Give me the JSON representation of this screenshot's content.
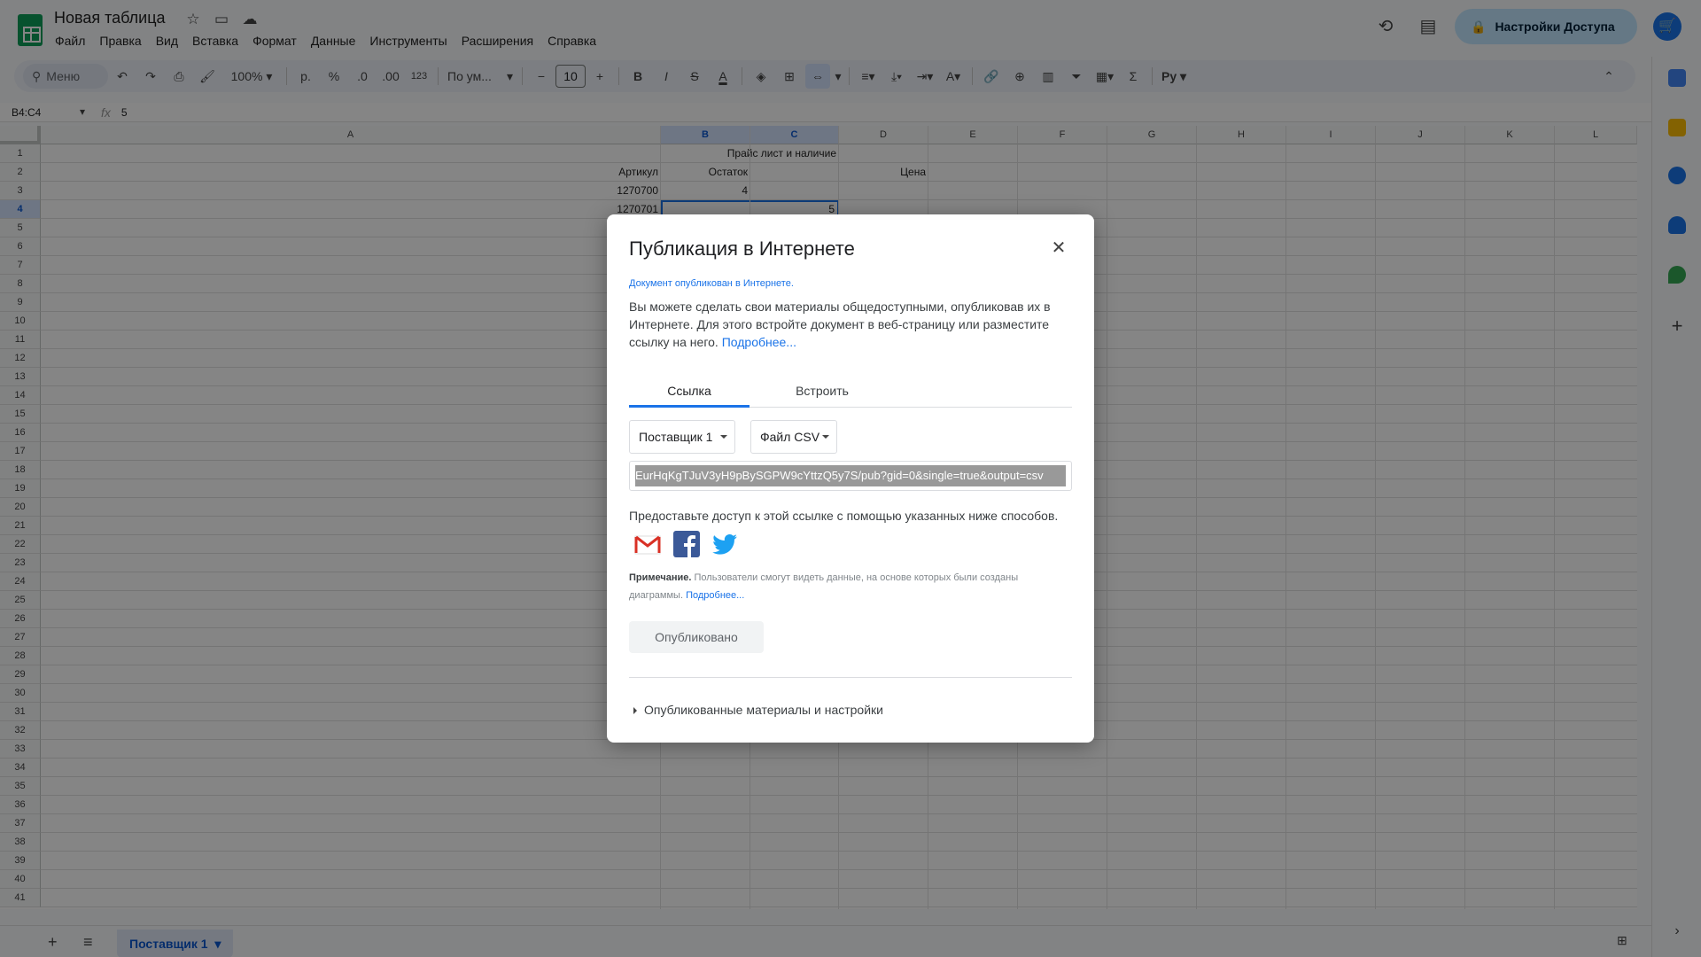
{
  "doc": {
    "title": "Новая таблица"
  },
  "menu": [
    "Файл",
    "Правка",
    "Вид",
    "Вставка",
    "Формат",
    "Данные",
    "Инструменты",
    "Расширения",
    "Справка"
  ],
  "header": {
    "share_label": "Настройки Доступа"
  },
  "toolbar": {
    "search_placeholder": "Меню",
    "zoom": "100%",
    "currency": "р.",
    "percent": "%",
    "dec_decrease": ".0",
    "dec_increase": ".00",
    "number_format": "123",
    "font": "По ум...",
    "font_size": "10",
    "bold": "B",
    "italic": "I",
    "strike": "S",
    "text_color": "A",
    "rotate": "A",
    "input_tools": "Ру"
  },
  "formula_bar": {
    "name_box": "B4:C4",
    "fx": "fx",
    "value": "5"
  },
  "columns": [
    "A",
    "B",
    "C",
    "D",
    "E",
    "F",
    "G",
    "H",
    "I",
    "J",
    "K",
    "L"
  ],
  "rows": [
    "1",
    "2",
    "3",
    "4",
    "5",
    "6",
    "7",
    "8",
    "9",
    "10",
    "11",
    "12",
    "13",
    "14",
    "15",
    "16",
    "17",
    "18",
    "19",
    "20",
    "21",
    "22",
    "23",
    "24",
    "25",
    "26",
    "27",
    "28",
    "29",
    "30",
    "31",
    "32",
    "33",
    "34",
    "35",
    "36",
    "37",
    "38",
    "39",
    "40",
    "41"
  ],
  "cells": {
    "b1": "Прайс лист и наличие",
    "a2": "Артикул",
    "b2": "Остаток",
    "d2": "Цена",
    "a3": "1270700",
    "b3": "4",
    "a4": "1270701",
    "c4": "5"
  },
  "sheets": [
    {
      "name": "Поставщик 1"
    }
  ],
  "dialog": {
    "title": "Публикация в Интернете",
    "status": "Документ опубликован в Интернете.",
    "description": "Вы можете сделать свои материалы общедоступными, опубликовав их в Интернете. Для этого встройте документ в веб-страницу или разместите ссылку на него.",
    "more_link": "Подробнее...",
    "tabs": [
      "Ссылка",
      "Встроить"
    ],
    "sheet_select": "Поставщик 1",
    "format_select": "Файл CSV",
    "url": "EurHqKgTJuV3yH9pBySGPW9cYttzQ5y7S/pub?gid=0&single=true&output=csv",
    "share_text": "Предоставьте доступ к этой ссылке с помощью указанных ниже способов.",
    "note_label": "Примечание.",
    "note_text": "Пользователи смогут видеть данные, на основе которых были созданы диаграммы.",
    "note_link": "Подробнее...",
    "published_button": "Опубликовано",
    "collapse_label": "Опубликованные материалы и настройки"
  },
  "colors": {
    "accent": "#1a73e8",
    "share_bg": "#c2e7ff",
    "sheets_green": "#0f9d58"
  }
}
